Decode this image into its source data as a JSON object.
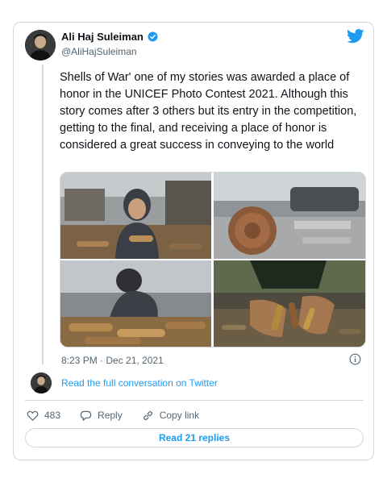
{
  "author": {
    "name": "Ali Haj Suleiman",
    "handle": "@AliHajSuleiman"
  },
  "tweet": {
    "text": "Shells of War' one of my stories was awarded a place of honor in the UNICEF Photo Contest 2021. Although this story comes after 3 others but its entry in the competition, getting to the final, and receiving a place of honor is considered a great success in conveying to the world",
    "timestamp": "8:23 PM · Dec 21, 2021"
  },
  "conversation_link": "Read the full conversation on Twitter",
  "actions": {
    "like_count": "483",
    "reply_label": "Reply",
    "copy_label": "Copy link"
  },
  "replies_button": "Read 21 replies",
  "colors": {
    "accent": "#1d9bf0",
    "border": "#cfd9de",
    "muted": "#536471"
  },
  "icons": [
    "verified-badge-icon",
    "twitter-bird-icon",
    "info-icon",
    "heart-icon",
    "reply-icon",
    "link-icon"
  ]
}
